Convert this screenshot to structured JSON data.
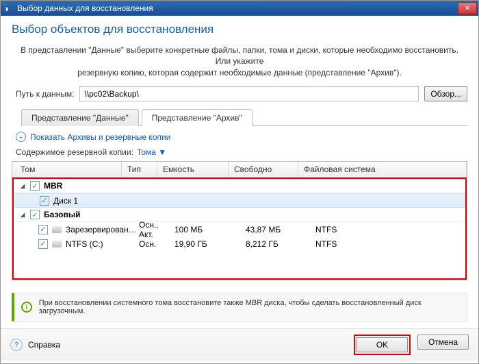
{
  "title": "Выбор данных для восстановления",
  "header": "Выбор объектов для восстановления",
  "description1": "В представлении \"Данные\" выберите конкретные файлы, папки, тома и диски, которые необходимо восстановить. Или укажите",
  "description2": "резервную копию, которая содержит необходимые данные (представление \"Архив\").",
  "path_label": "Путь к данным:",
  "path_value": "\\\\pc02\\Backup\\",
  "browse_btn": "Обзор...",
  "tabs": {
    "data": "Представление \"Данные\"",
    "archive": "Представление \"Архив\""
  },
  "show_archives_link": "Показать Архивы и резервные копии",
  "content_label": "Содержимое резервной копии:",
  "content_value": "Тома ▼",
  "cols": {
    "vol": "Том",
    "type": "Тип",
    "cap": "Емкость",
    "free": "Свободно",
    "fs": "Файловая система"
  },
  "groups": {
    "mbr": "MBR",
    "disk1": "Диск 1",
    "basic": "Базовый"
  },
  "rows": [
    {
      "vol": "Зарезервирован…",
      "type": "Осн., Акт.",
      "cap": "100 МБ",
      "free": "43,87 МБ",
      "fs": "NTFS"
    },
    {
      "vol": "NTFS (C:)",
      "type": "Осн.",
      "cap": "19,90 ГБ",
      "free": "8,212 ГБ",
      "fs": "NTFS"
    }
  ],
  "hint": "При восстановлении системного тома восстановите также MBR диска, чтобы сделать восстановленный диск загрузочным.",
  "help": "Справка",
  "ok": "OK",
  "cancel": "Отмена"
}
